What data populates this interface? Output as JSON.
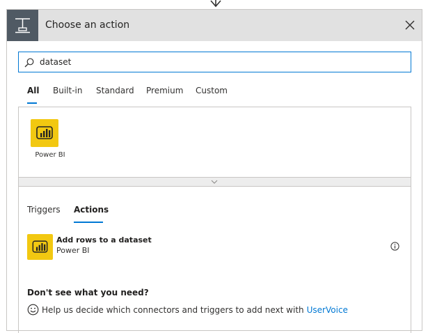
{
  "dialog": {
    "title": "Choose an action",
    "close_icon": "close-icon",
    "header_icon": "action-step-icon"
  },
  "search": {
    "value": "dataset",
    "icon": "search-icon"
  },
  "filter_tabs": [
    {
      "label": "All",
      "active": true
    },
    {
      "label": "Built-in",
      "active": false
    },
    {
      "label": "Standard",
      "active": false
    },
    {
      "label": "Premium",
      "active": false
    },
    {
      "label": "Custom",
      "active": false
    }
  ],
  "connectors": [
    {
      "label": "Power BI",
      "icon": "power-bi-icon"
    }
  ],
  "result_tabs": [
    {
      "label": "Triggers",
      "active": false
    },
    {
      "label": "Actions",
      "active": true
    }
  ],
  "actions": [
    {
      "title": "Add rows to a dataset",
      "connector": "Power BI",
      "icon": "power-bi-icon"
    }
  ],
  "help": {
    "heading": "Don't see what you need?",
    "text": "Help us decide which connectors and triggers to add next with",
    "link": "UserVoice",
    "icon": "smiley-icon"
  },
  "colors": {
    "accent": "#0078d4",
    "power_bi": "#f2c811",
    "header_bg": "#e1e1e1",
    "header_icon_bg": "#505a64"
  }
}
